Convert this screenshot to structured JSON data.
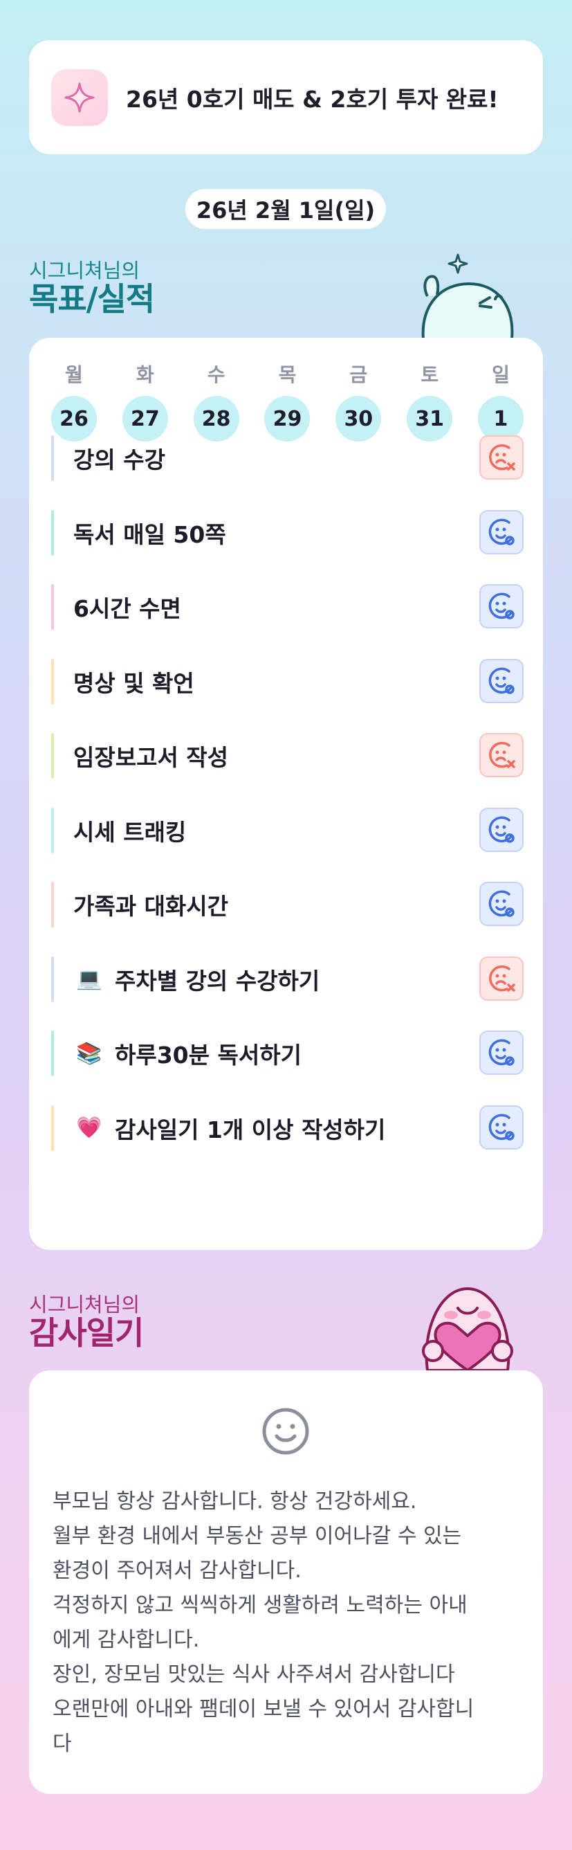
{
  "banner": {
    "text": "26년 0호기 매도 & 2호기 투자 완료!",
    "icon": "sparkle-icon"
  },
  "date_label": "26년 2월 1일(일)",
  "goals_section": {
    "subtitle": "시그니쳐님의",
    "title": "목표/실적"
  },
  "week": [
    {
      "label": "월",
      "date": "26"
    },
    {
      "label": "화",
      "date": "27"
    },
    {
      "label": "수",
      "date": "28"
    },
    {
      "label": "목",
      "date": "29"
    },
    {
      "label": "금",
      "date": "30"
    },
    {
      "label": "토",
      "date": "31"
    },
    {
      "label": "일",
      "date": "1"
    }
  ],
  "tasks": [
    {
      "label": "강의 수강",
      "bar_color": "#d4dbf5",
      "status": "not-done",
      "emoji": ""
    },
    {
      "label": "독서 매일 50쪽",
      "bar_color": "#b2ecdf",
      "status": "done",
      "emoji": ""
    },
    {
      "label": "6시간 수면",
      "bar_color": "#f8c7df",
      "status": "done",
      "emoji": ""
    },
    {
      "label": "명상 및 확언",
      "bar_color": "#fde1b3",
      "status": "done",
      "emoji": ""
    },
    {
      "label": "임장보고서 작성",
      "bar_color": "#d9efb0",
      "status": "not-done",
      "emoji": ""
    },
    {
      "label": "시세 트래킹",
      "bar_color": "#bdeef3",
      "status": "done",
      "emoji": ""
    },
    {
      "label": "가족과 대화시간",
      "bar_color": "#fcd2cf",
      "status": "done",
      "emoji": ""
    },
    {
      "label": "주차별 강의 수강하기",
      "bar_color": "#d4dbf5",
      "status": "not-done",
      "emoji": "💻"
    },
    {
      "label": "하루30분 독서하기",
      "bar_color": "#b2ecdf",
      "status": "done",
      "emoji": "📚"
    },
    {
      "label": "감사일기 1개 이상 작성하기",
      "bar_color": "#fde1b3",
      "status": "done",
      "emoji": "💗"
    }
  ],
  "thanks_section": {
    "subtitle": "시그니쳐님의",
    "title": "감사일기"
  },
  "gratitude": [
    "부모님 항상 감사합니다. 항상 건강하세요.",
    "월부 환경 내에서 부동산 공부 이어나갈 수 있는",
    "환경이 주어져서 감사합니다.",
    "걱정하지 않고 씩씩하게 생활하려 노력하는 아내",
    "에게 감사합니다.",
    "장인, 장모님 맛있는 식사 사주셔서 감사합니다",
    "오랜만에 아내와 팸데이 보낼 수 있어서 감사합니",
    "다"
  ],
  "colors": {
    "done": "#3f6fe0",
    "not_done": "#f26a5e",
    "accent_teal": "#147a86",
    "accent_pink": "#a0246f"
  }
}
